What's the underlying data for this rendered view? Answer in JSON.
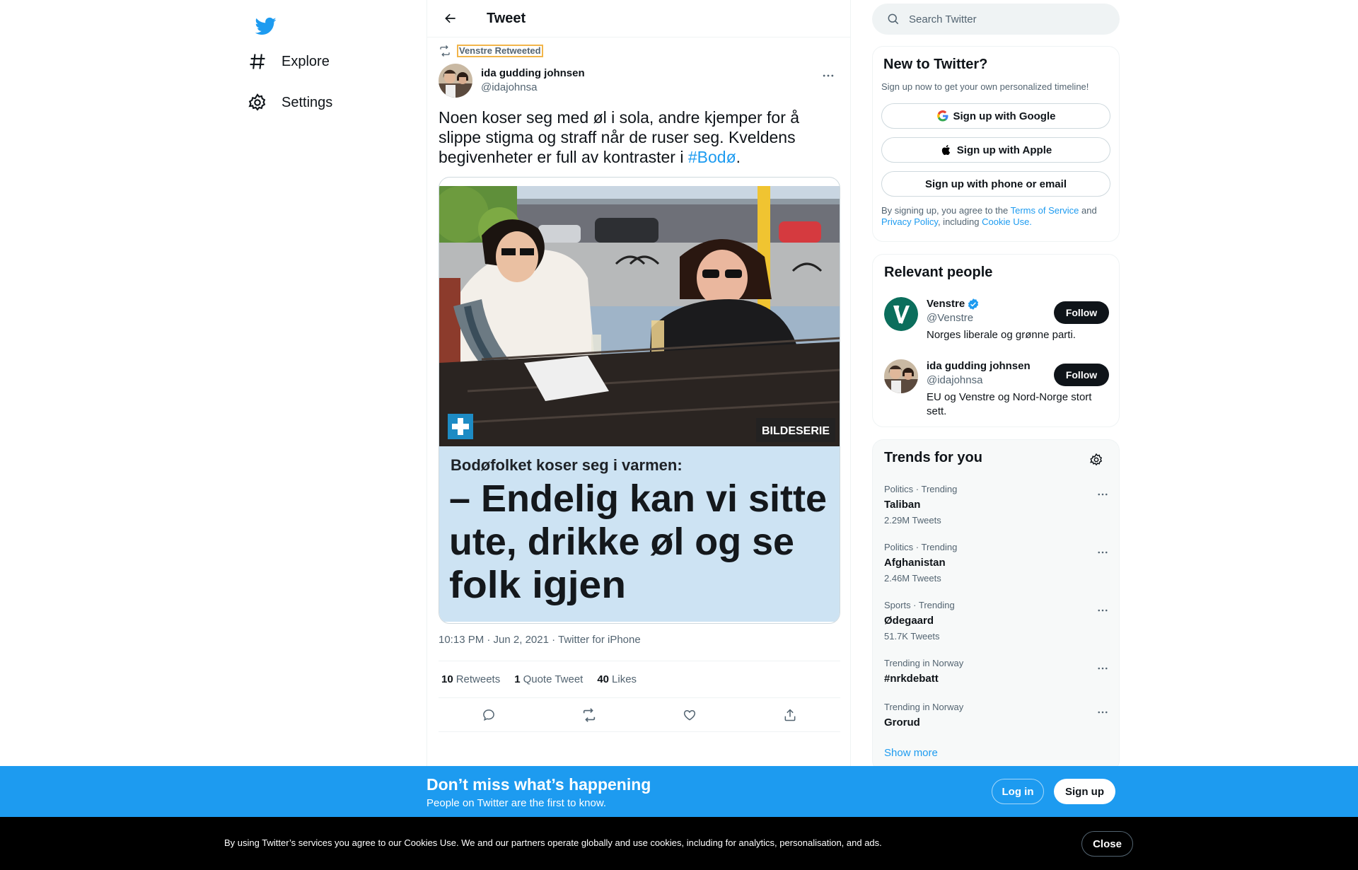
{
  "nav": {
    "logo_icon": "twitter-bird-icon",
    "items": [
      {
        "label": "Explore",
        "icon": "hashtag-icon"
      },
      {
        "label": "Settings",
        "icon": "gear-icon"
      }
    ]
  },
  "header": {
    "title": "Tweet",
    "back_icon": "arrow-left-icon"
  },
  "tweet": {
    "retweeted_by": "Venstre Retweeted",
    "author_name": "ida gudding johnsen",
    "author_handle": "@idajohnsa",
    "text_before": "Noen koser seg med øl i sola, andre kjemper for å slippe stigma og straff når de ruser seg. Kveldens begivenheter er full av kontraster i ",
    "hashtag": "#Bodø",
    "text_after": ".",
    "media": {
      "badge": "BILDESERIE",
      "kicker": "Bodøfolket koser seg i varmen:",
      "headline": [
        "– Endelig kan vi sitte",
        "ute, drikke øl og se",
        "folk igjen"
      ]
    },
    "timestamp": "10:13 PM · Jun 2, 2021 · Twitter for iPhone",
    "stats": {
      "retweets_count": "10",
      "retweets_label": "Retweets",
      "quotes_count": "1",
      "quotes_label": "Quote Tweet",
      "likes_count": "40",
      "likes_label": "Likes"
    }
  },
  "search": {
    "placeholder": "Search Twitter"
  },
  "new_to_twitter": {
    "title": "New to Twitter?",
    "subtitle": "Sign up now to get your own personalized timeline!",
    "google": "Sign up with Google",
    "apple": "Sign up with Apple",
    "email": "Sign up with phone or email",
    "terms_prefix": "By signing up, you agree to the ",
    "terms_link": "Terms of Service",
    "terms_and": " and ",
    "privacy_link": "Privacy Policy",
    "terms_including": ", including ",
    "cookie_link": "Cookie Use."
  },
  "relevant_people": {
    "title": "Relevant people",
    "people": [
      {
        "name": "Venstre",
        "handle": "@Venstre",
        "bio": "Norges liberale og grønne parti.",
        "follow": "Follow"
      },
      {
        "name": "ida gudding johnsen",
        "handle": "@idajohnsa",
        "bio": "EU og Venstre og Nord-Norge stort sett.",
        "follow": "Follow"
      }
    ]
  },
  "trends": {
    "title": "Trends for you",
    "items": [
      {
        "meta": "Politics · Trending",
        "name": "Taliban",
        "count": "2.29M Tweets"
      },
      {
        "meta": "Politics · Trending",
        "name": "Afghanistan",
        "count": "2.46M Tweets"
      },
      {
        "meta": "Sports · Trending",
        "name": "Ødegaard",
        "count": "51.7K Tweets"
      },
      {
        "meta": "Trending in Norway",
        "name": "#nrkdebatt",
        "count": ""
      },
      {
        "meta": "Trending in Norway",
        "name": "Grorud",
        "count": ""
      }
    ],
    "show_more": "Show more"
  },
  "banner": {
    "title": "Don’t miss what’s happening",
    "subtitle": "People on Twitter are the first to know.",
    "login": "Log in",
    "signup": "Sign up"
  },
  "cookie": {
    "text": "By using Twitter’s services you agree to our Cookies Use. We and our partners operate globally and use cookies, including for analytics, personalisation, and ads.",
    "close": "Close"
  },
  "colors": {
    "accent": "#1d9bf0",
    "text": "#0f1419",
    "muted": "#536471",
    "banner": "#1d9bf0"
  }
}
